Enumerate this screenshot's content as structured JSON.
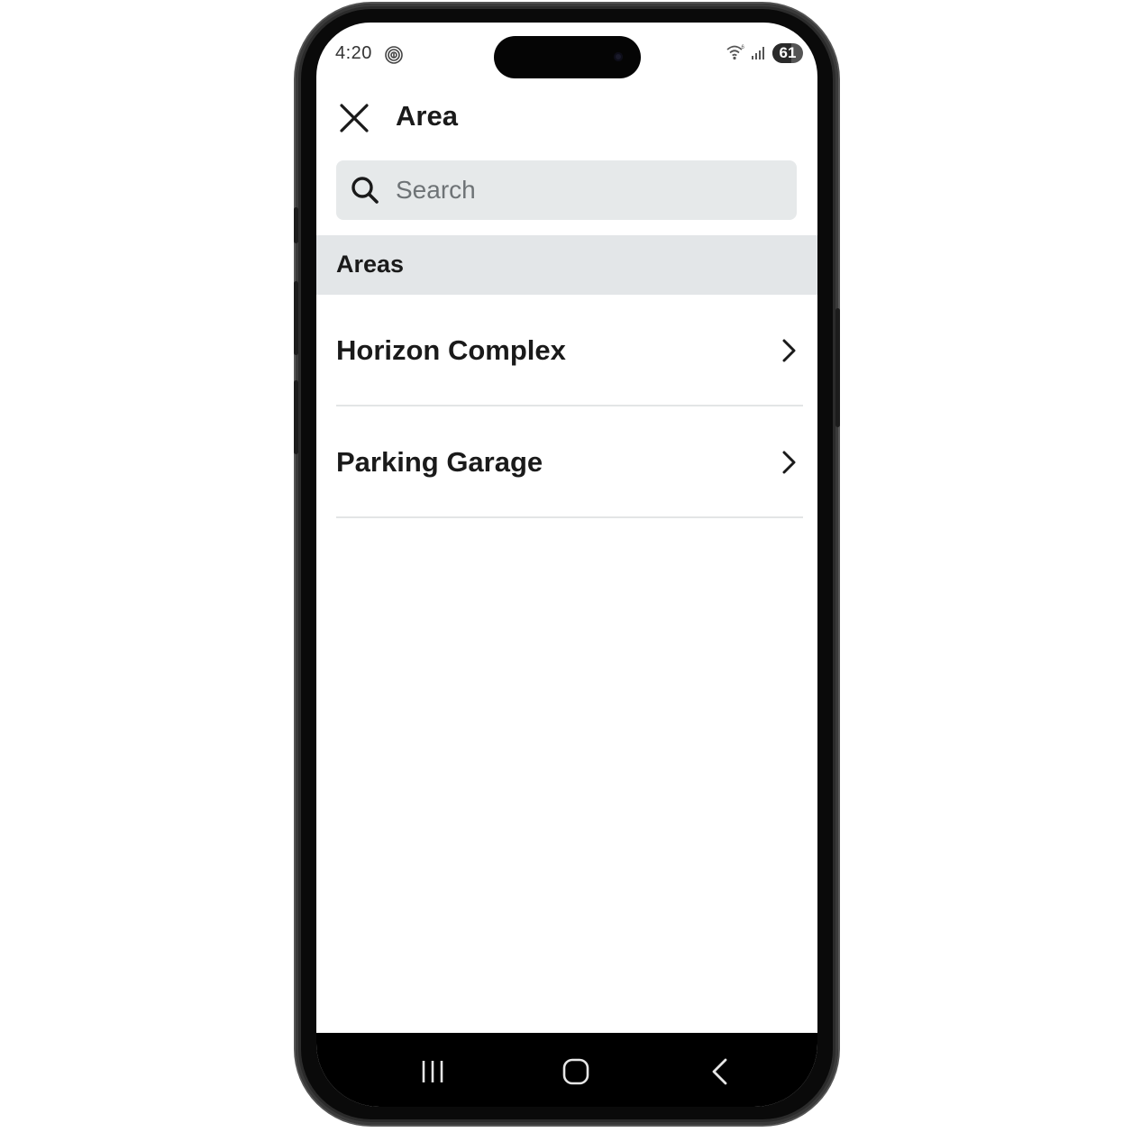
{
  "status_bar": {
    "time": "4:20",
    "battery_level": "61",
    "battery_fraction": 0.61,
    "icons": [
      "fingerprint-icon",
      "wifi-icon",
      "signal-icon",
      "battery-icon"
    ]
  },
  "header": {
    "title": "Area",
    "close_icon": "close-icon"
  },
  "search": {
    "placeholder": "Search",
    "value": "",
    "icon": "search-icon"
  },
  "section": {
    "title": "Areas"
  },
  "areas": [
    {
      "label": "Horizon Complex",
      "icon": "chevron-right-icon"
    },
    {
      "label": "Parking Garage",
      "icon": "chevron-right-icon"
    }
  ],
  "nav_bar": {
    "buttons": [
      "recent-apps-icon",
      "home-icon",
      "back-icon"
    ]
  },
  "colors": {
    "search_bg": "#e6e9ea",
    "section_bg": "#e3e6e8",
    "text": "#1a1a1a",
    "placeholder": "#6e7376",
    "divider": "#e3e5e6"
  }
}
